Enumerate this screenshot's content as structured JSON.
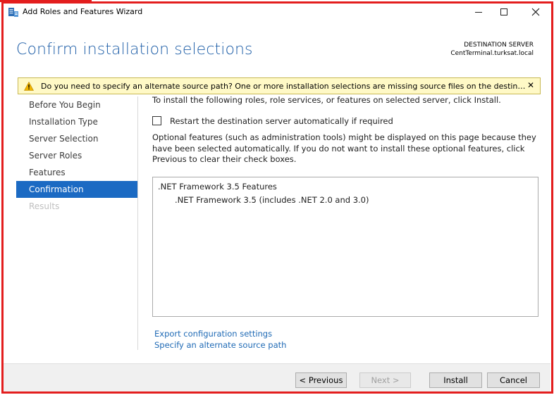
{
  "window": {
    "title": "Add Roles and Features Wizard"
  },
  "controls": {
    "minimize_icon": "minimize-icon",
    "maximize_icon": "maximize-icon",
    "close_icon": "close-icon"
  },
  "header": {
    "title": "Confirm installation selections",
    "destination_label": "DESTINATION SERVER",
    "destination_server": "CentTerminal.turksat.local"
  },
  "warning": {
    "text": "Do you need to specify an alternate source path? One or more installation selections are missing source files on the destinati...",
    "close_glyph": "✕"
  },
  "nav": {
    "items": [
      {
        "label": "Before You Begin",
        "state": "normal"
      },
      {
        "label": "Installation Type",
        "state": "normal"
      },
      {
        "label": "Server Selection",
        "state": "normal"
      },
      {
        "label": "Server Roles",
        "state": "normal"
      },
      {
        "label": "Features",
        "state": "normal"
      },
      {
        "label": "Confirmation",
        "state": "active"
      },
      {
        "label": "Results",
        "state": "disabled"
      }
    ]
  },
  "content": {
    "intro": "To install the following roles, role services, or features on selected server, click Install.",
    "restart_label": "Restart the destination server automatically if required",
    "restart_checked": false,
    "optional_text": "Optional features (such as administration tools) might be displayed on this page because they have been selected automatically. If you do not want to install these optional features, click Previous to clear their check boxes.",
    "features": [
      {
        "label": ".NET Framework 3.5 Features",
        "level": 0
      },
      {
        "label": ".NET Framework 3.5 (includes .NET 2.0 and 3.0)",
        "level": 1
      }
    ],
    "links": {
      "export": "Export configuration settings",
      "alternate": "Specify an alternate source path"
    }
  },
  "footer": {
    "previous": "< Previous",
    "next": "Next >",
    "install": "Install",
    "cancel": "Cancel"
  },
  "colors": {
    "accent": "#1b6ac3",
    "title": "#1f5fa8",
    "warning_bg": "#fff9c6",
    "annotation": "#e31e1e"
  }
}
